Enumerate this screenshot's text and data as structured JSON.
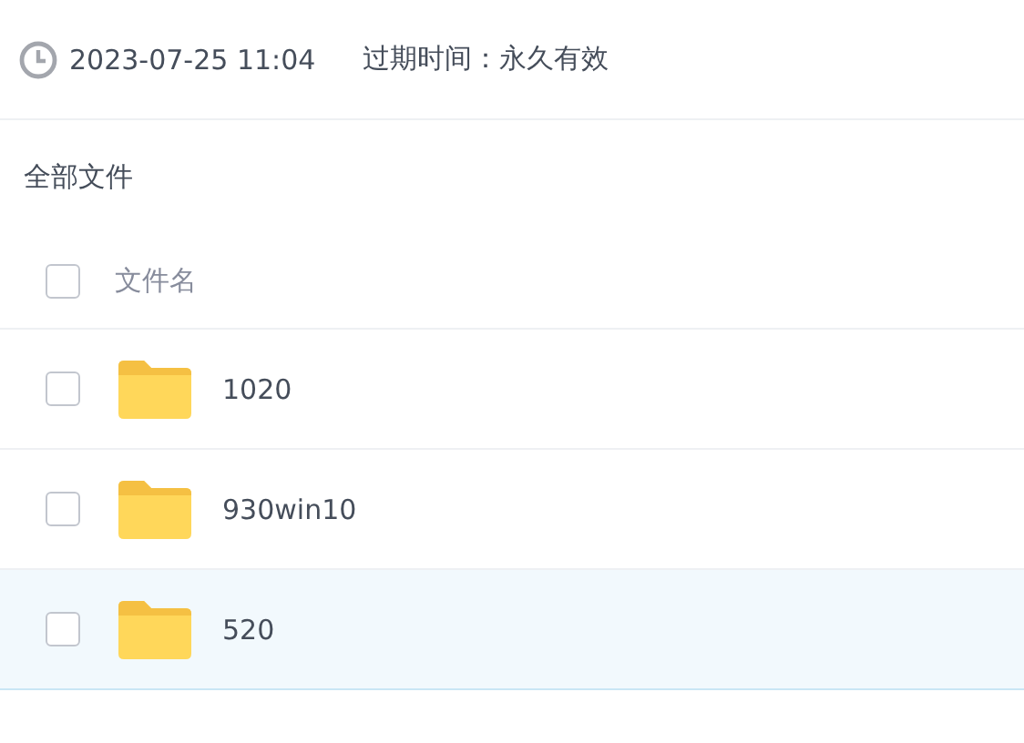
{
  "share_info": {
    "time": "2023-07-25 11:04",
    "expiry": "过期时间：永久有效"
  },
  "breadcrumb": "全部文件",
  "table": {
    "header": {
      "label": "文件名",
      "checked": false
    },
    "rows": [
      {
        "name": "1020",
        "checked": false,
        "selected": false
      },
      {
        "name": "930win10",
        "checked": false,
        "selected": false
      },
      {
        "name": "520",
        "checked": false,
        "selected": true
      }
    ]
  }
}
